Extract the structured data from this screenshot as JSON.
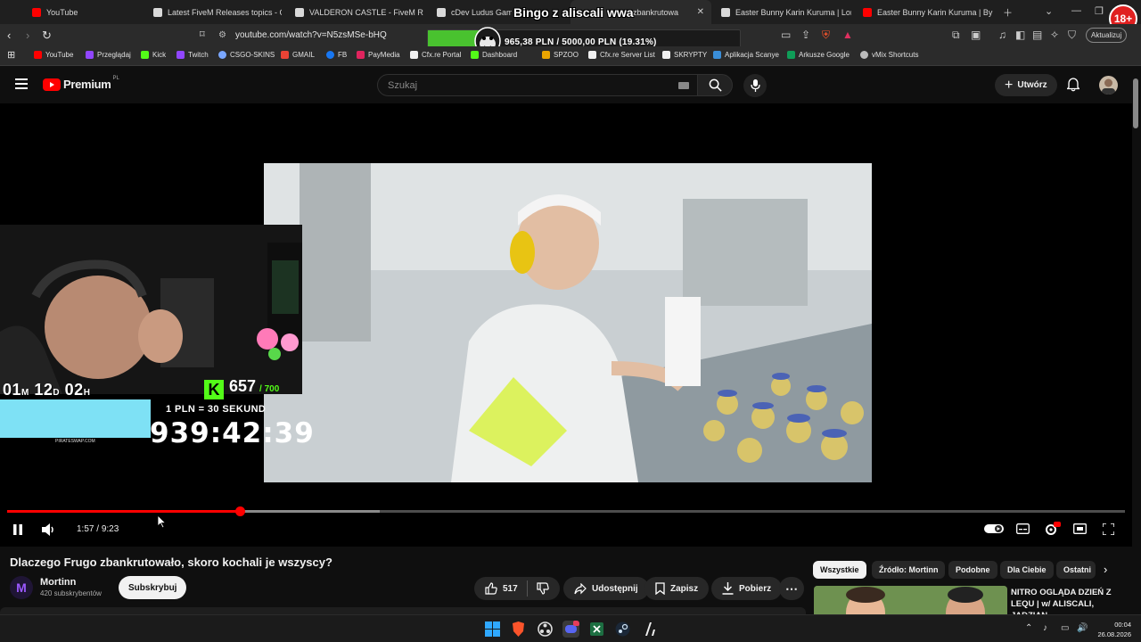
{
  "browser": {
    "tabs": [
      {
        "title": "YouTube",
        "color": "#ff0000"
      },
      {
        "title": "Latest FiveM Releases topics - Cfx.r",
        "color": "#f0f0f0"
      },
      {
        "title": "VALDERON CASTLE - FiveM Release",
        "color": "#f0f0f0"
      },
      {
        "title": "cDev Ludus Gaming",
        "color": "#f0f0f0"
      },
      {
        "title": "zbankrutowa",
        "color": "#ff0000"
      },
      {
        "title": "Easter Bunny Karin Kuruma | Lore F",
        "color": "#f0f0f0"
      },
      {
        "title": "Easter Bunny Karin Kuruma | By Mo",
        "color": "#ff0000"
      }
    ],
    "url": "youtube.com/watch?v=N5zsMSe-bHQ",
    "update_label": "Aktualizuj",
    "age_badge": "18+",
    "bookmarks": [
      {
        "label": "YouTube",
        "color": "#ff0000"
      },
      {
        "label": "Przeglądaj",
        "color": "#9146ff"
      },
      {
        "label": "Kick",
        "color": "#53fc18"
      },
      {
        "label": "Twitch",
        "color": "#9146ff"
      },
      {
        "label": "CSGO-SKINS",
        "color": "#7aa7ff"
      },
      {
        "label": "GMAIL",
        "color": "#ea4335"
      },
      {
        "label": "FB",
        "color": "#1877f2"
      },
      {
        "label": "PayMedia",
        "color": "#e0245e"
      },
      {
        "label": "Cfx.re Portal",
        "color": "#f0f0f0"
      },
      {
        "label": "Dashboard",
        "color": "#53fc18"
      },
      {
        "label": "SPZOO",
        "color": "#e9a400"
      },
      {
        "label": "Cfx.re Server List",
        "color": "#f0f0f0"
      },
      {
        "label": "SKRYPTY",
        "color": "#f0f0f0"
      },
      {
        "label": "Aplikacja Scanye",
        "color": "#3a8ed8"
      },
      {
        "label": "Arkusze Google",
        "color": "#0f9d58"
      },
      {
        "label": "vMix Shortcuts",
        "color": "#bbbbbb"
      }
    ]
  },
  "stream_overlay": {
    "bingo_title": "Bingo z aliscali wwa",
    "donation_amount": "965,38 PLN / 5000,00 PLN (19.31%)",
    "donation_progress": 0.1931,
    "countdown_small": {
      "m": "01",
      "m_unit": "M",
      "d": "12",
      "d_unit": "D",
      "h": "02",
      "h_unit": "H"
    },
    "kick_count": "657",
    "kick_max": "/ 700",
    "rate_text": "1 PLN = 30 SEKUND",
    "timer": "939:42:39",
    "site_label": "PIRATESWAP.COM"
  },
  "youtube": {
    "logo_text": "Premium",
    "logo_region": "PL",
    "search_placeholder": "Szukaj",
    "create_label": "Utwórz",
    "player": {
      "current_time": "1:57",
      "separator": "/",
      "duration": "9:23",
      "played_fraction": 0.208,
      "buffered_fraction": 0.333
    },
    "video_title": "Dlaczego Frugo zbankrutowało, skoro kochali je wszyscy?",
    "channel": {
      "name": "Mortinn",
      "subscribers": "420 subskrybentów",
      "avatar_letter": "M"
    },
    "subscribe_label": "Subskrybuj",
    "likes": "517",
    "share_label": "Udostępnij",
    "save_label": "Zapisz",
    "download_label": "Pobierz",
    "chips": [
      "Wszystkie",
      "Źródło: Mortinn",
      "Podobne",
      "Dla Ciebie",
      "Ostatni"
    ],
    "recommended": {
      "line1": "NITRO OGLĄDA DZIEŃ Z",
      "line2": "LEQU | w/ ALISCALI,",
      "line3": "JADZIAN..."
    }
  },
  "taskbar": {
    "time": "00:04",
    "date": "26.08.2026"
  }
}
